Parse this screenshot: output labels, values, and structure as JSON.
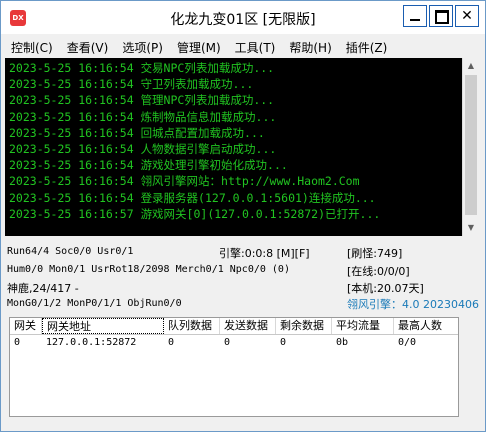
{
  "window": {
    "title": "化龙九变01区 [无限版]",
    "icon_label": "DX",
    "close_glyph": "✕"
  },
  "menu": [
    {
      "label": "控制(C)"
    },
    {
      "label": "查看(V)"
    },
    {
      "label": "选项(P)"
    },
    {
      "label": "管理(M)"
    },
    {
      "label": "工具(T)"
    },
    {
      "label": "帮助(H)"
    },
    {
      "label": "插件(Z)"
    }
  ],
  "log": [
    {
      "time": "2023-5-25 16:16:54",
      "msg": "交易NPC列表加载成功..."
    },
    {
      "time": "2023-5-25 16:16:54",
      "msg": "守卫列表加载成功..."
    },
    {
      "time": "2023-5-25 16:16:54",
      "msg": "管理NPC列表加载成功..."
    },
    {
      "time": "2023-5-25 16:16:54",
      "msg": "炼制物品信息加载成功..."
    },
    {
      "time": "2023-5-25 16:16:54",
      "msg": "回城点配置加载成功..."
    },
    {
      "time": "2023-5-25 16:16:54",
      "msg": "人物数据引擎启动成功..."
    },
    {
      "time": "2023-5-25 16:16:54",
      "msg": "游戏处理引擎初始化成功..."
    },
    {
      "time": "2023-5-25 16:16:54",
      "msg": "翎风引擎网站：http://www.Haom2.Com"
    },
    {
      "time": "2023-5-25 16:16:54",
      "msg": "登录服务器(127.0.0.1:5601)连接成功..."
    },
    {
      "time": "2023-5-25 16:16:57",
      "msg": "游戏网关[0](127.0.0.1:52872)已打开..."
    }
  ],
  "status": {
    "row1_left": "Run64/4 Soc0/0 Usr0/1",
    "row1_mid": "引擎:0:0:8 [M][F]",
    "row1_right": "[刷怪:749]",
    "row2_left": "Hum0/0 Mon0/1 UsrRot18/2098 Merch0/1 Npc0/0 (0)",
    "row2_right": "[在线:0/0/0]",
    "row3_left": "神鹿,24/417 -",
    "row3_right": "[本机:20.07天]",
    "row4_left": "MonG0/1/2 MonP0/1/1 ObjRun0/0",
    "row4_right": "翎风引擎：4.0 20230406"
  },
  "table": {
    "columns": [
      "网关",
      "网关地址",
      "队列数据",
      "发送数据",
      "剩余数据",
      "平均流量",
      "最高人数"
    ],
    "rows": [
      [
        "0",
        "127.0.0.1:52872",
        "0",
        "0",
        "0",
        "0b",
        "0/0"
      ]
    ]
  },
  "colors": {
    "log_text": "#21c421",
    "log_bg": "#000000",
    "engine_version": "#1a7ab8",
    "window_border": "#6b9ac8"
  }
}
